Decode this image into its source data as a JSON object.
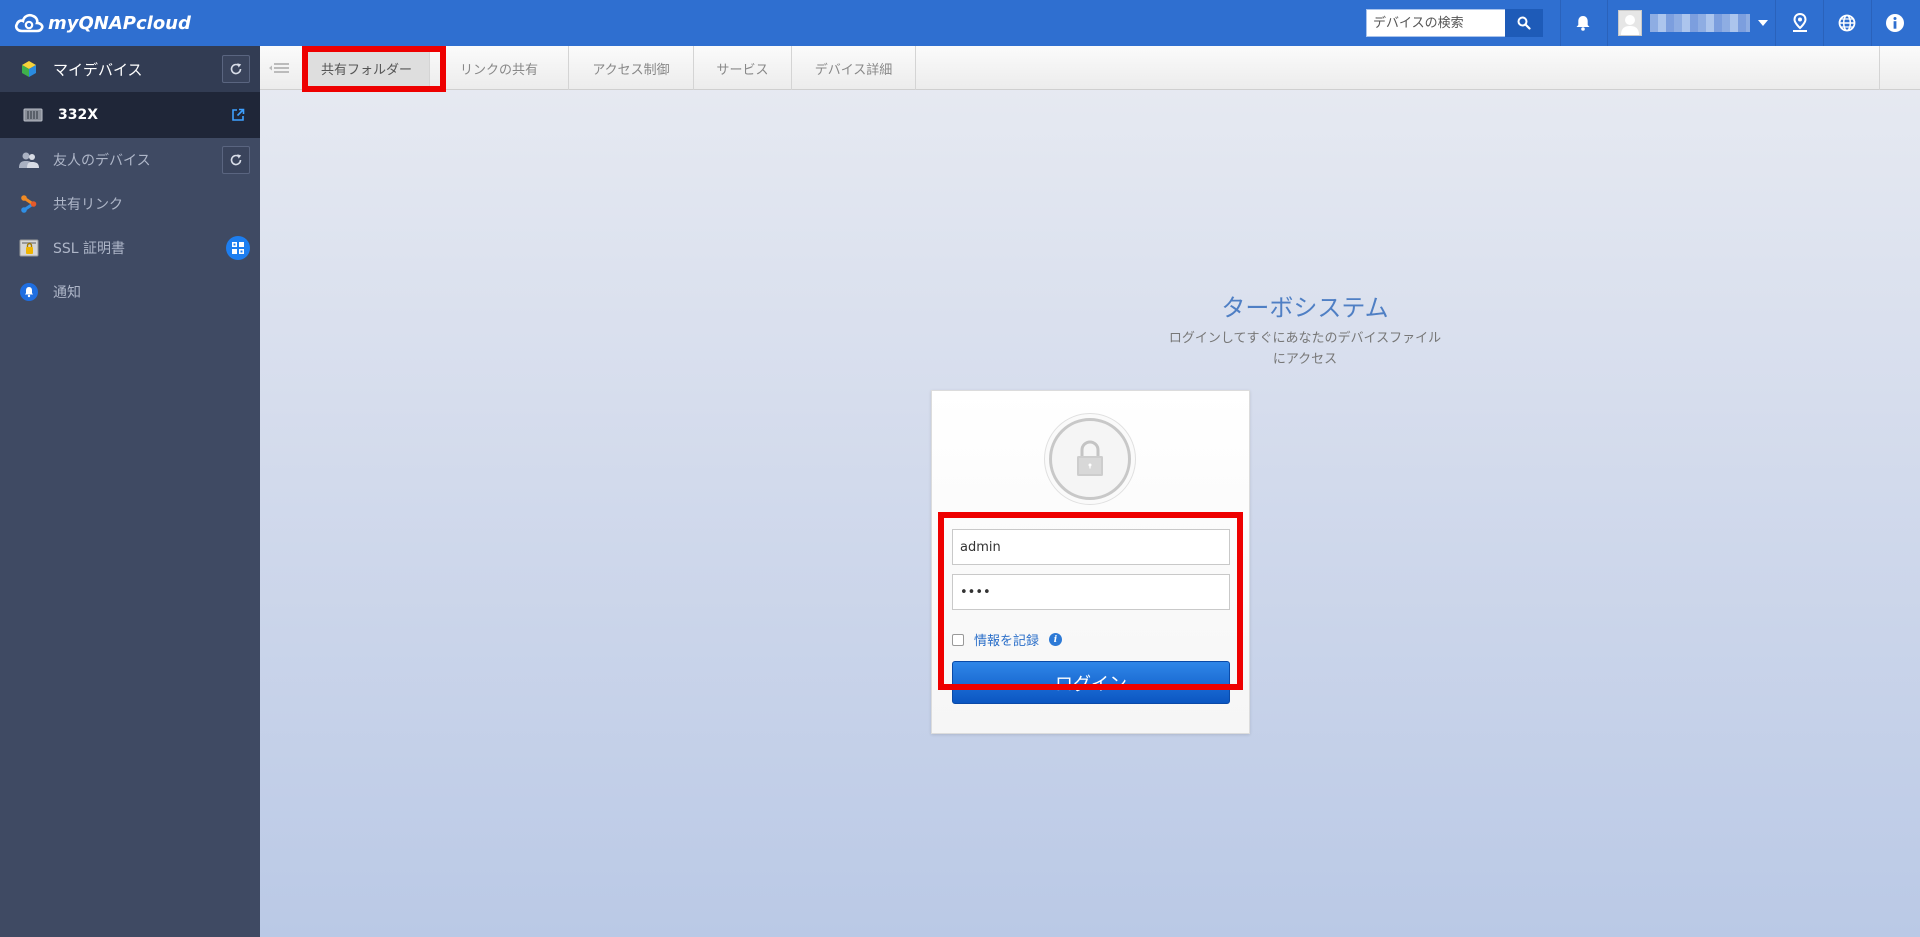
{
  "app": {
    "logo_text": "myQNAPcloud"
  },
  "header": {
    "search_placeholder": "デバイスの検索"
  },
  "sidebar": {
    "my_devices": "マイデバイス",
    "device_name": "332X",
    "friends_devices": "友人のデバイス",
    "shared_links": "共有リンク",
    "ssl": "SSL 証明書",
    "notifications": "通知"
  },
  "tabs": [
    {
      "label": "共有フォルダー",
      "active": true
    },
    {
      "label": "リンクの共有",
      "active": false
    },
    {
      "label": "アクセス制御",
      "active": false
    },
    {
      "label": "サービス",
      "active": false
    },
    {
      "label": "デバイス詳細",
      "active": false
    }
  ],
  "login": {
    "title": "ターボシステム",
    "subtitle_line1": "ログインしてすぐにあなたのデバイスファイル",
    "subtitle_line2": "にアクセス",
    "username_value": "admin",
    "password_value": "••••",
    "remember_label": "情報を記録",
    "info_glyph": "i",
    "login_button": "ログイン"
  },
  "colors": {
    "topbar": "#2f6fd0",
    "sidebar": "#3f4a63",
    "highlight": "#ee0000",
    "button": "#0b56c2"
  }
}
